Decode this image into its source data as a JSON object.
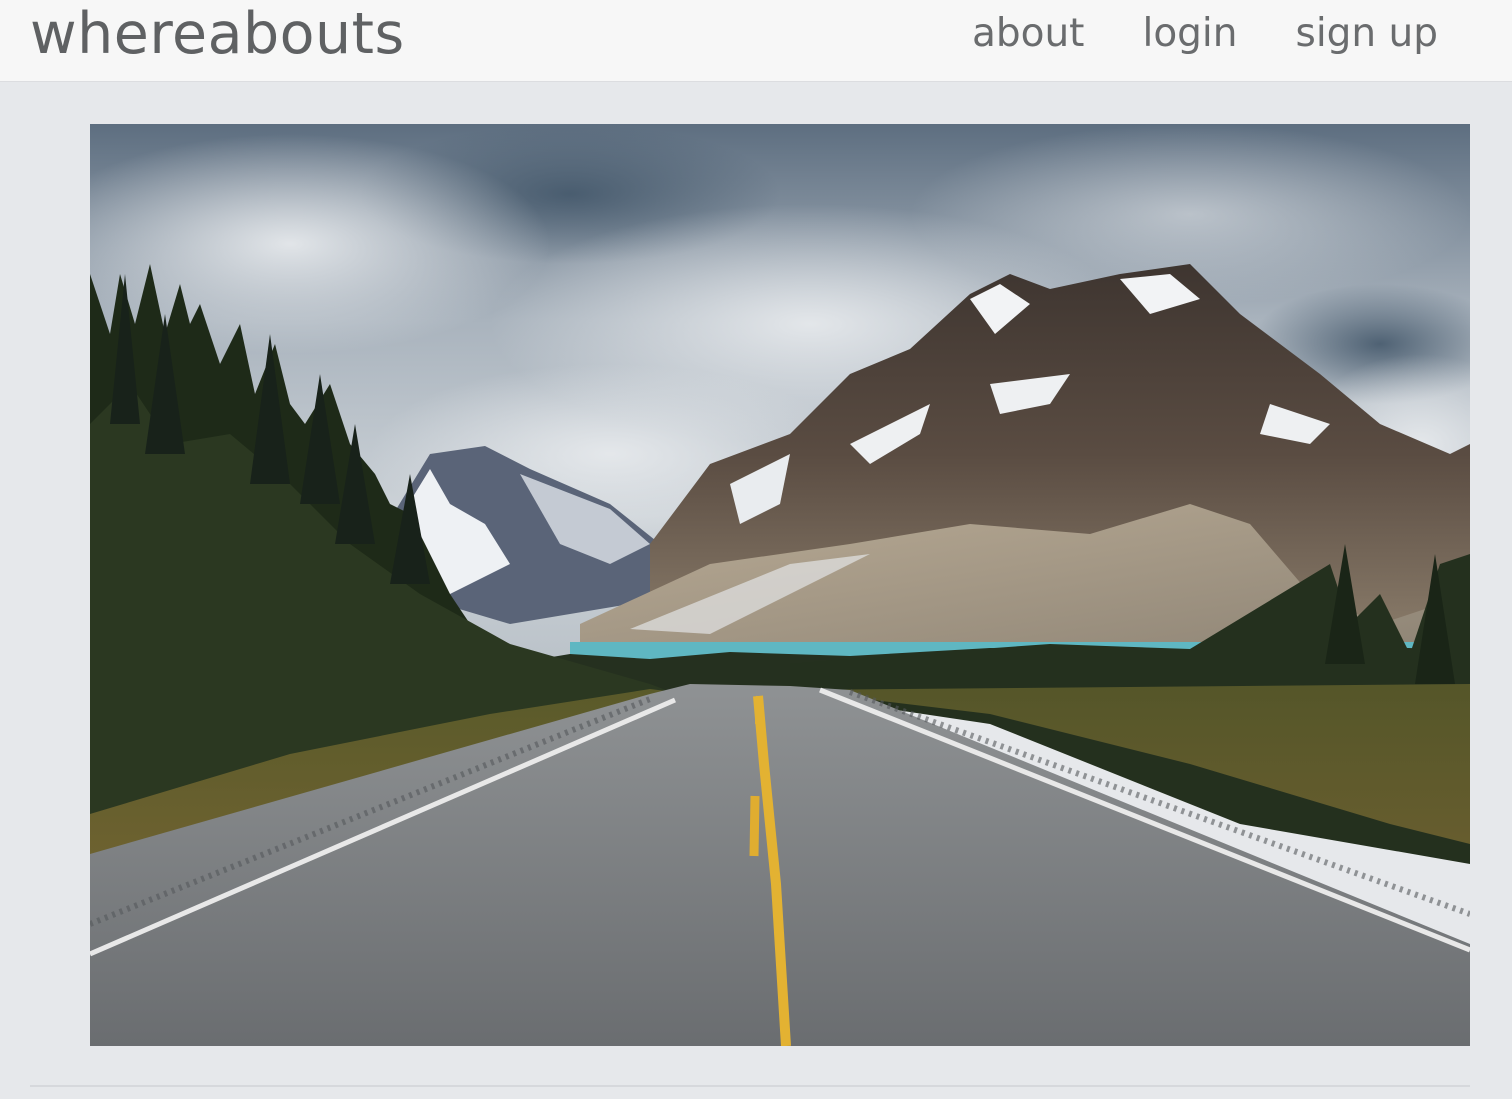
{
  "navbar": {
    "brand": "whereabouts",
    "links": [
      {
        "label": "about"
      },
      {
        "label": "login"
      },
      {
        "label": "sign up"
      }
    ]
  },
  "hero": {
    "subject": "mountain-road-landscape-photo"
  },
  "colors": {
    "page_background": "#e6e8eb",
    "navbar_background": "#f7f7f7",
    "text": "#5f6163"
  }
}
